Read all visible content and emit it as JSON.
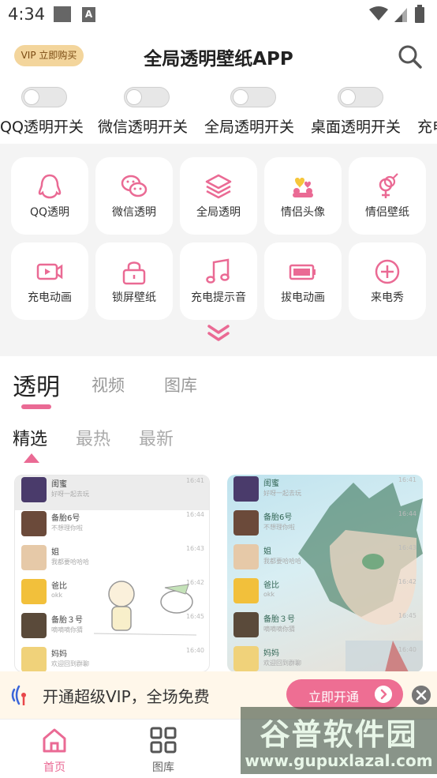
{
  "status_bar": {
    "time": "4:34",
    "notif_icon_letter": "A"
  },
  "header": {
    "vip_badge": "VIP 立即购买",
    "title": "全局透明壁纸APP",
    "search_icon": "search-icon"
  },
  "toggles": [
    {
      "label": "QQ透明开关",
      "on": false
    },
    {
      "label": "微信透明开关",
      "on": false
    },
    {
      "label": "全局透明开关",
      "on": false
    },
    {
      "label": "桌面透明开关",
      "on": false
    },
    {
      "label": "充电",
      "on": false
    }
  ],
  "grid": [
    {
      "label": "QQ透明",
      "icon": "penguin-icon"
    },
    {
      "label": "微信透明",
      "icon": "wechat-icon"
    },
    {
      "label": "全局透明",
      "icon": "layers-icon"
    },
    {
      "label": "情侣头像",
      "icon": "couple-avatar-icon"
    },
    {
      "label": "情侣壁纸",
      "icon": "couple-gender-icon"
    },
    {
      "label": "充电动画",
      "icon": "video-icon"
    },
    {
      "label": "锁屏壁纸",
      "icon": "lock-icon"
    },
    {
      "label": "充电提示音",
      "icon": "music-note-icon"
    },
    {
      "label": "拔电动画",
      "icon": "battery-icon"
    },
    {
      "label": "来电秀",
      "icon": "plus-circle-icon"
    }
  ],
  "main_tabs": [
    "透明",
    "视频",
    "图库"
  ],
  "sub_tabs": [
    "精选",
    "最热",
    "最新"
  ],
  "chat_list": [
    {
      "name": "闺蜜",
      "msg": "好呀一起去玩",
      "time": "16:41"
    },
    {
      "name": "备胎6号",
      "msg": "不想理你啦",
      "time": "16:44"
    },
    {
      "name": "姐",
      "msg": "我都要哈哈哈",
      "time": "16:43"
    },
    {
      "name": "爸比",
      "msg": "okk",
      "time": "16:42"
    },
    {
      "name": "备胎３号",
      "msg": "嘀嘀嘀你猜",
      "time": "16:45"
    },
    {
      "name": "妈妈",
      "msg": "欢迎回到群聊",
      "time": "16:40"
    }
  ],
  "vip_banner": {
    "text": "开通超级VIP，全场免费",
    "button": "立即开通"
  },
  "bottom_nav": [
    {
      "label": "首页",
      "icon": "home-icon",
      "active": true
    },
    {
      "label": "图库",
      "icon": "grid-icon",
      "active": false
    }
  ],
  "watermark": {
    "title": "谷普软件园",
    "url": "www.gupuxlazal.com"
  },
  "colors": {
    "accent": "#ea6a94",
    "vip_gold": "#f3d59c"
  }
}
